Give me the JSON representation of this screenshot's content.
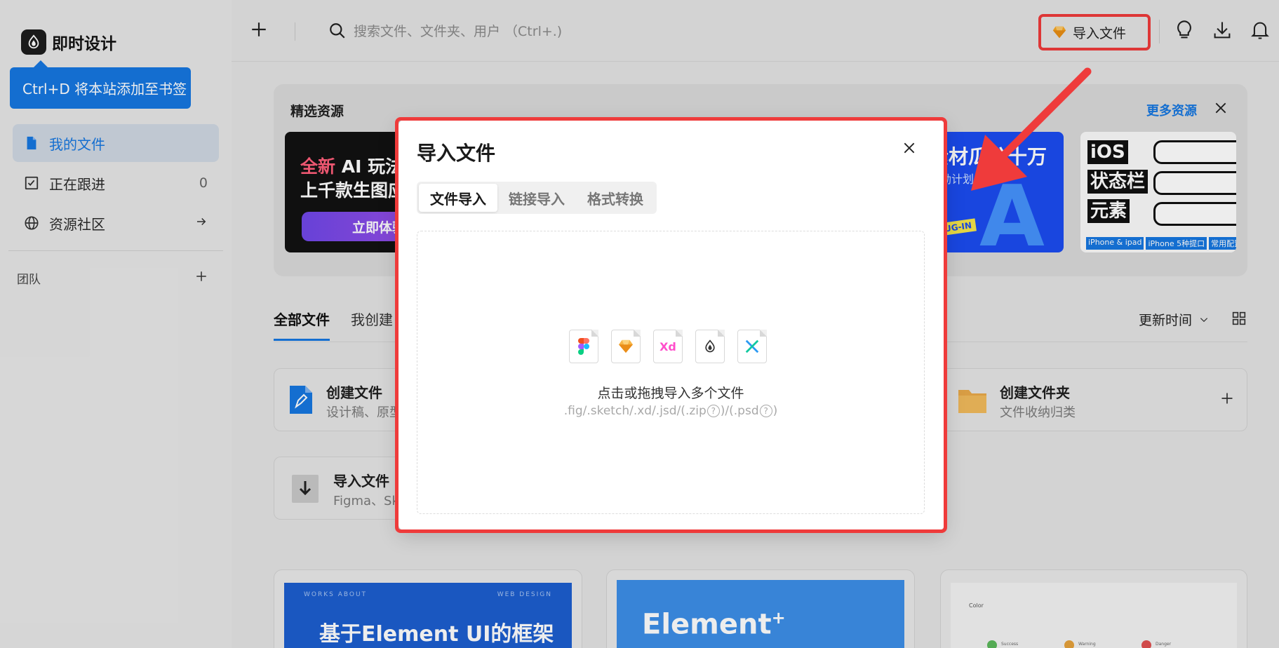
{
  "sidebar": {
    "brand_name": "即时设计",
    "tooltip": "Ctrl+D 将本站添加至书签",
    "items": [
      {
        "label": "我的文件",
        "active": true
      },
      {
        "label": "正在跟进",
        "count": "0"
      },
      {
        "label": "资源社区"
      }
    ],
    "team_label": "团队"
  },
  "topbar": {
    "search_placeholder": "搜索文件、文件夹、用户 （Ctrl+.)",
    "import_label": "导入文件"
  },
  "featured": {
    "title": "精选资源",
    "more": "更多资源",
    "card_ai": {
      "line1_em": "全新",
      "line1_rest": " AI 玩法",
      "line2": "上千款生图应",
      "cta": "立即体验"
    },
    "card_blue": {
      "t1": "素材瓜分十万",
      "t2": "激励计划",
      "plug": "PLUG-IN"
    },
    "card_ios": {
      "words": [
        "iOS",
        "状态栏",
        "元素"
      ],
      "chips": [
        "iPhone & ipad",
        "iPhone 5种提口",
        "常用配置"
      ]
    }
  },
  "files": {
    "tabs": [
      "全部文件",
      "我创建"
    ],
    "sort_label": "更新时间",
    "create_file": {
      "title": "创建文件",
      "subtitle": "设计稿、原型"
    },
    "create_folder": {
      "title": "创建文件夹",
      "subtitle": "文件收纳归类"
    },
    "import_file": {
      "title": "导入文件",
      "subtitle": "Figma、Sk"
    }
  },
  "templates": [
    {
      "small_left": "WORKS   ABOUT",
      "small_right": "WEB   DESIGN",
      "title": "基于Element UI的框架"
    },
    {
      "title": "Element",
      "sup": "+"
    },
    {
      "title": "Color",
      "items": [
        "Success",
        "Warning",
        "Danger"
      ]
    }
  ],
  "modal": {
    "title": "导入文件",
    "tabs": [
      "文件导入",
      "链接导入",
      "格式转换"
    ],
    "active_tab": "文件导入",
    "formats": [
      "figma-icon",
      "sketch-icon",
      "xd-icon",
      "jsd-icon",
      "axure-icon"
    ],
    "drop_main": "点击或拖拽导入多个文件",
    "drop_sub_a": ".fig/.sketch/.xd/.jsd/(.zip",
    "drop_sub_b": ")/(.psd",
    "drop_sub_c": ")",
    "help_mark": "?"
  },
  "colors": {
    "accent": "#1677e0",
    "highlight": "#ef3b3b"
  }
}
